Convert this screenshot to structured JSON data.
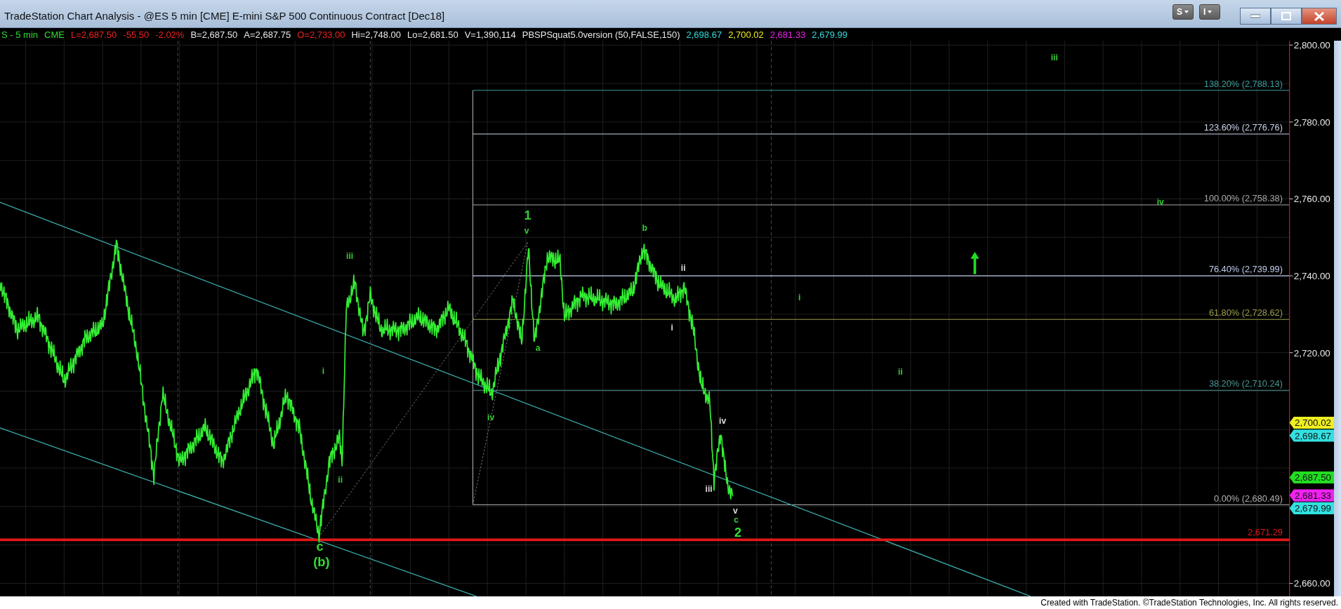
{
  "window": {
    "title": "TradeStation Chart Analysis - @ES 5 min [CME] E-mini S&P 500 Continuous Contract [Dec18]",
    "menu_buttons": [
      "S",
      "I"
    ]
  },
  "info_bar": [
    {
      "text": "S - 5 min",
      "color": "#33dd33"
    },
    {
      "text": "CME",
      "color": "#33dd33"
    },
    {
      "text": "L=2,687.50",
      "color": "#ee2222"
    },
    {
      "text": "-55.50",
      "color": "#ee2222"
    },
    {
      "text": "-2.02%",
      "color": "#ee2222"
    },
    {
      "text": "B=2,687.50",
      "color": "#e8e8e8"
    },
    {
      "text": "A=2,687.75",
      "color": "#e8e8e8"
    },
    {
      "text": "O=2,733.00",
      "color": "#ee2222"
    },
    {
      "text": "Hi=2,748.00",
      "color": "#e8e8e8"
    },
    {
      "text": "Lo=2,681.50",
      "color": "#e8e8e8"
    },
    {
      "text": "V=1,390,114",
      "color": "#e8e8e8"
    },
    {
      "text": "PBSPSquat5.0version (50,FALSE,150)",
      "color": "#e8e8e8"
    },
    {
      "text": "2,698.67",
      "color": "#33dddd"
    },
    {
      "text": "2,700.02",
      "color": "#eeee22"
    },
    {
      "text": "2,681.33",
      "color": "#ee22ee"
    },
    {
      "text": "2,679.99",
      "color": "#33dddd"
    }
  ],
  "price_axis": [
    "2,800.00",
    "2,780.00",
    "2,760.00",
    "2,740.00",
    "2,720.00",
    "2,660.00"
  ],
  "fib_levels": [
    {
      "label": "138.20% (2,788.13)",
      "color": "#3c9c9c"
    },
    {
      "label": "123.60% (2,776.76)",
      "color": "#c8d4ec"
    },
    {
      "label": "100.00% (2,758.38)",
      "color": "#a8a8a8"
    },
    {
      "label": "76.40% (2,739.99)",
      "color": "#c0ccec"
    },
    {
      "label": "61.80% (2,728.62)",
      "color": "#9c9c4c"
    },
    {
      "label": "38.20% (2,710.24)",
      "color": "#4a9494"
    },
    {
      "label": "0.00% (2,680.49)",
      "color": "#b0b0b0"
    }
  ],
  "support_line": {
    "label": "2,671.29"
  },
  "price_tags": [
    {
      "text": "2,700.02",
      "color": "#eeee22"
    },
    {
      "text": "2,698.67",
      "color": "#33e0e0"
    },
    {
      "text": "2,687.50",
      "color": "#22dd22"
    },
    {
      "text": "2,681.33",
      "color": "#ee22ee"
    },
    {
      "text": "2,679.99",
      "color": "#33e0e0"
    }
  ],
  "wave_labels": [
    {
      "text": "iii",
      "kind": "minor",
      "color": "#33cc33"
    },
    {
      "text": "iv",
      "kind": "minor",
      "color": "#33cc33"
    },
    {
      "text": "1",
      "kind": "major",
      "color": "#33cc33"
    },
    {
      "text": "v",
      "kind": "minor",
      "color": "#33cc33"
    },
    {
      "text": "b",
      "kind": "minor",
      "color": "#33cc33"
    },
    {
      "text": "ii",
      "kind": "minor",
      "color": "#dddddd"
    },
    {
      "text": "iii",
      "kind": "minor",
      "color": "#33cc33"
    },
    {
      "text": "i",
      "kind": "minor",
      "color": "#33cc33"
    },
    {
      "text": "i",
      "kind": "minor",
      "color": "#dddddd"
    },
    {
      "text": "a",
      "kind": "minor",
      "color": "#33cc33"
    },
    {
      "text": "i",
      "kind": "minor",
      "color": "#33cc33"
    },
    {
      "text": "ii",
      "kind": "minor",
      "color": "#33cc33"
    },
    {
      "text": "iv",
      "kind": "minor",
      "color": "#33cc33"
    },
    {
      "text": "iv",
      "kind": "minor",
      "color": "#dddddd"
    },
    {
      "text": "ii",
      "kind": "minor",
      "color": "#33cc33"
    },
    {
      "text": "iii",
      "kind": "minor",
      "color": "#dddddd"
    },
    {
      "text": "v",
      "kind": "minor",
      "color": "#dddddd"
    },
    {
      "text": "c",
      "kind": "minor",
      "color": "#33cc33"
    },
    {
      "text": "2",
      "kind": "major",
      "color": "#33dd33"
    },
    {
      "text": "c",
      "kind": "major",
      "color": "#33dd33"
    },
    {
      "text": "(b)",
      "kind": "major",
      "color": "#33dd33"
    }
  ],
  "footer": "Created with TradeStation. ©TradeStation Technologies, Inc. All rights reserved."
}
